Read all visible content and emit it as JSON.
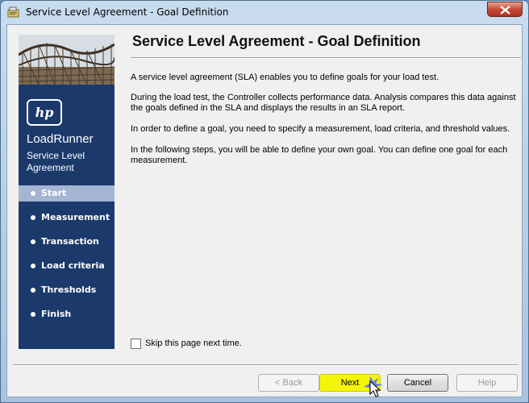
{
  "window": {
    "title": "Service Level Agreement - Goal Definition"
  },
  "sidebar": {
    "brand": "LoadRunner",
    "subtitle": "Service Level Agreement",
    "items": [
      {
        "label": "Start",
        "active": true
      },
      {
        "label": "Measurement"
      },
      {
        "label": "Transaction"
      },
      {
        "label": "Load criteria"
      },
      {
        "label": "Thresholds"
      },
      {
        "label": "Finish"
      }
    ]
  },
  "main": {
    "heading": "Service Level Agreement - Goal Definition",
    "paragraphs": [
      "A service level agreement (SLA) enables you to define goals for your load test.",
      "During the load test, the Controller collects performance data. Analysis compares this data against the goals defined in the SLA and displays the results in an SLA report.",
      "In order to define a goal, you need to specify a measurement, load criteria, and threshold values.",
      "In the following steps, you will be able to define your own goal. You can define one goal for each measurement."
    ],
    "skip_checkbox": {
      "label": "Skip this page next time.",
      "checked": false
    }
  },
  "buttons": {
    "back": "< Back",
    "next": "Next",
    "cancel": "Cancel",
    "help": "Help"
  },
  "colors": {
    "sidebar": "#1b3a6b",
    "active_item": "#a3b5d2",
    "highlight": "#f5f50a"
  }
}
